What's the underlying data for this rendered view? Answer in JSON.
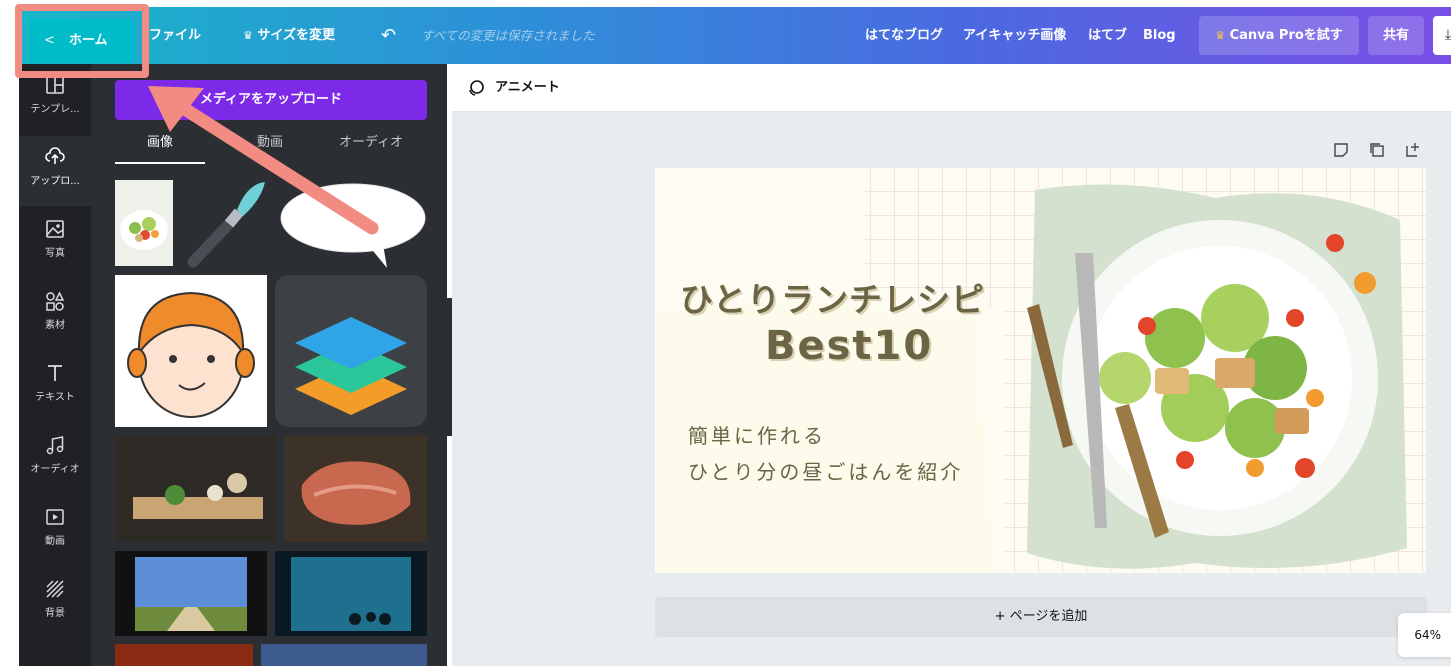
{
  "topbar": {
    "home_label": "ホーム",
    "file_label": "ファイル",
    "resize_label": "サイズを変更",
    "saved_status": "すべての変更は保存されました",
    "links": [
      "はてなブログ",
      "アイキャッチ画像",
      "はてブ",
      "Blog"
    ],
    "pro_label": "Canva Proを試す",
    "share_label": "共有"
  },
  "rail": {
    "items": [
      {
        "label": "テンプレ...",
        "icon": "template-icon"
      },
      {
        "label": "アップロ...",
        "icon": "upload-icon"
      },
      {
        "label": "写真",
        "icon": "photo-icon"
      },
      {
        "label": "素材",
        "icon": "elements-icon"
      },
      {
        "label": "テキスト",
        "icon": "text-icon"
      },
      {
        "label": "オーディオ",
        "icon": "audio-icon"
      },
      {
        "label": "動画",
        "icon": "video-icon"
      },
      {
        "label": "背景",
        "icon": "background-icon"
      }
    ]
  },
  "panel": {
    "upload_label": "メディアをアップロード",
    "tabs": [
      "画像",
      "動画",
      "オーディオ"
    ]
  },
  "editor": {
    "animate_label": "アニメート",
    "add_page_label": "+ ページを追加",
    "zoom": "64%"
  },
  "design": {
    "title_line1": "ひとりランチレシピ",
    "title_line2": "Best10",
    "subtitle_line1": "簡単に作れる",
    "subtitle_line2": "ひとり分の昼ごはんを紹介"
  },
  "colors": {
    "accent_purple": "#7d2ae8",
    "home_teal": "#00bcc8",
    "highlight": "#f28b82"
  }
}
